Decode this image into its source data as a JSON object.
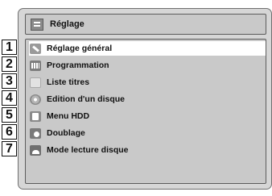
{
  "header": {
    "title": "Réglage",
    "icon": "settings-menu-icon"
  },
  "menu": {
    "items": [
      {
        "number": "1",
        "label": "Réglage général",
        "icon": "wrench-icon",
        "selected": true
      },
      {
        "number": "2",
        "label": "Programmation",
        "icon": "timer-program-icon",
        "selected": false
      },
      {
        "number": "3",
        "label": "Liste titres",
        "icon": "title-list-icon",
        "selected": false
      },
      {
        "number": "4",
        "label": "Edition d'un disque",
        "icon": "disc-icon",
        "selected": false
      },
      {
        "number": "5",
        "label": "Menu HDD",
        "icon": "hdd-icon",
        "selected": false
      },
      {
        "number": "6",
        "label": "Doublage",
        "icon": "dubbing-icon",
        "selected": false
      },
      {
        "number": "7",
        "label": "Mode lecture disque",
        "icon": "disc-playback-icon",
        "selected": false
      }
    ]
  }
}
